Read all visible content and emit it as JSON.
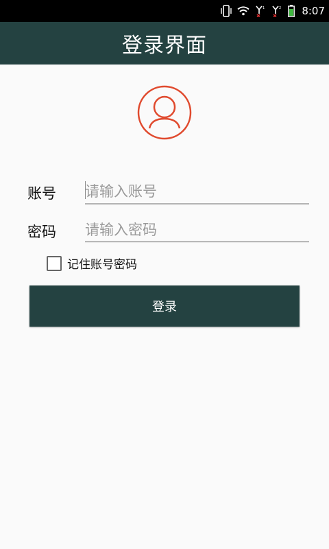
{
  "status_bar": {
    "time": "8:07",
    "icons": [
      "vibrate-icon",
      "wifi-icon",
      "signal-sim1-icon",
      "signal-sim2-icon",
      "battery-icon"
    ]
  },
  "app_bar": {
    "title": "登录界面",
    "color": "#244241"
  },
  "avatar": {
    "icon": "user-avatar-icon",
    "color": "#e04a2e"
  },
  "form": {
    "account": {
      "label": "账号",
      "placeholder": "请输入账号",
      "value": ""
    },
    "password": {
      "label": "密码",
      "placeholder": "请输入密码",
      "value": ""
    },
    "remember": {
      "label": "记住账号密码",
      "checked": false
    },
    "login_button": {
      "label": "登录"
    }
  }
}
